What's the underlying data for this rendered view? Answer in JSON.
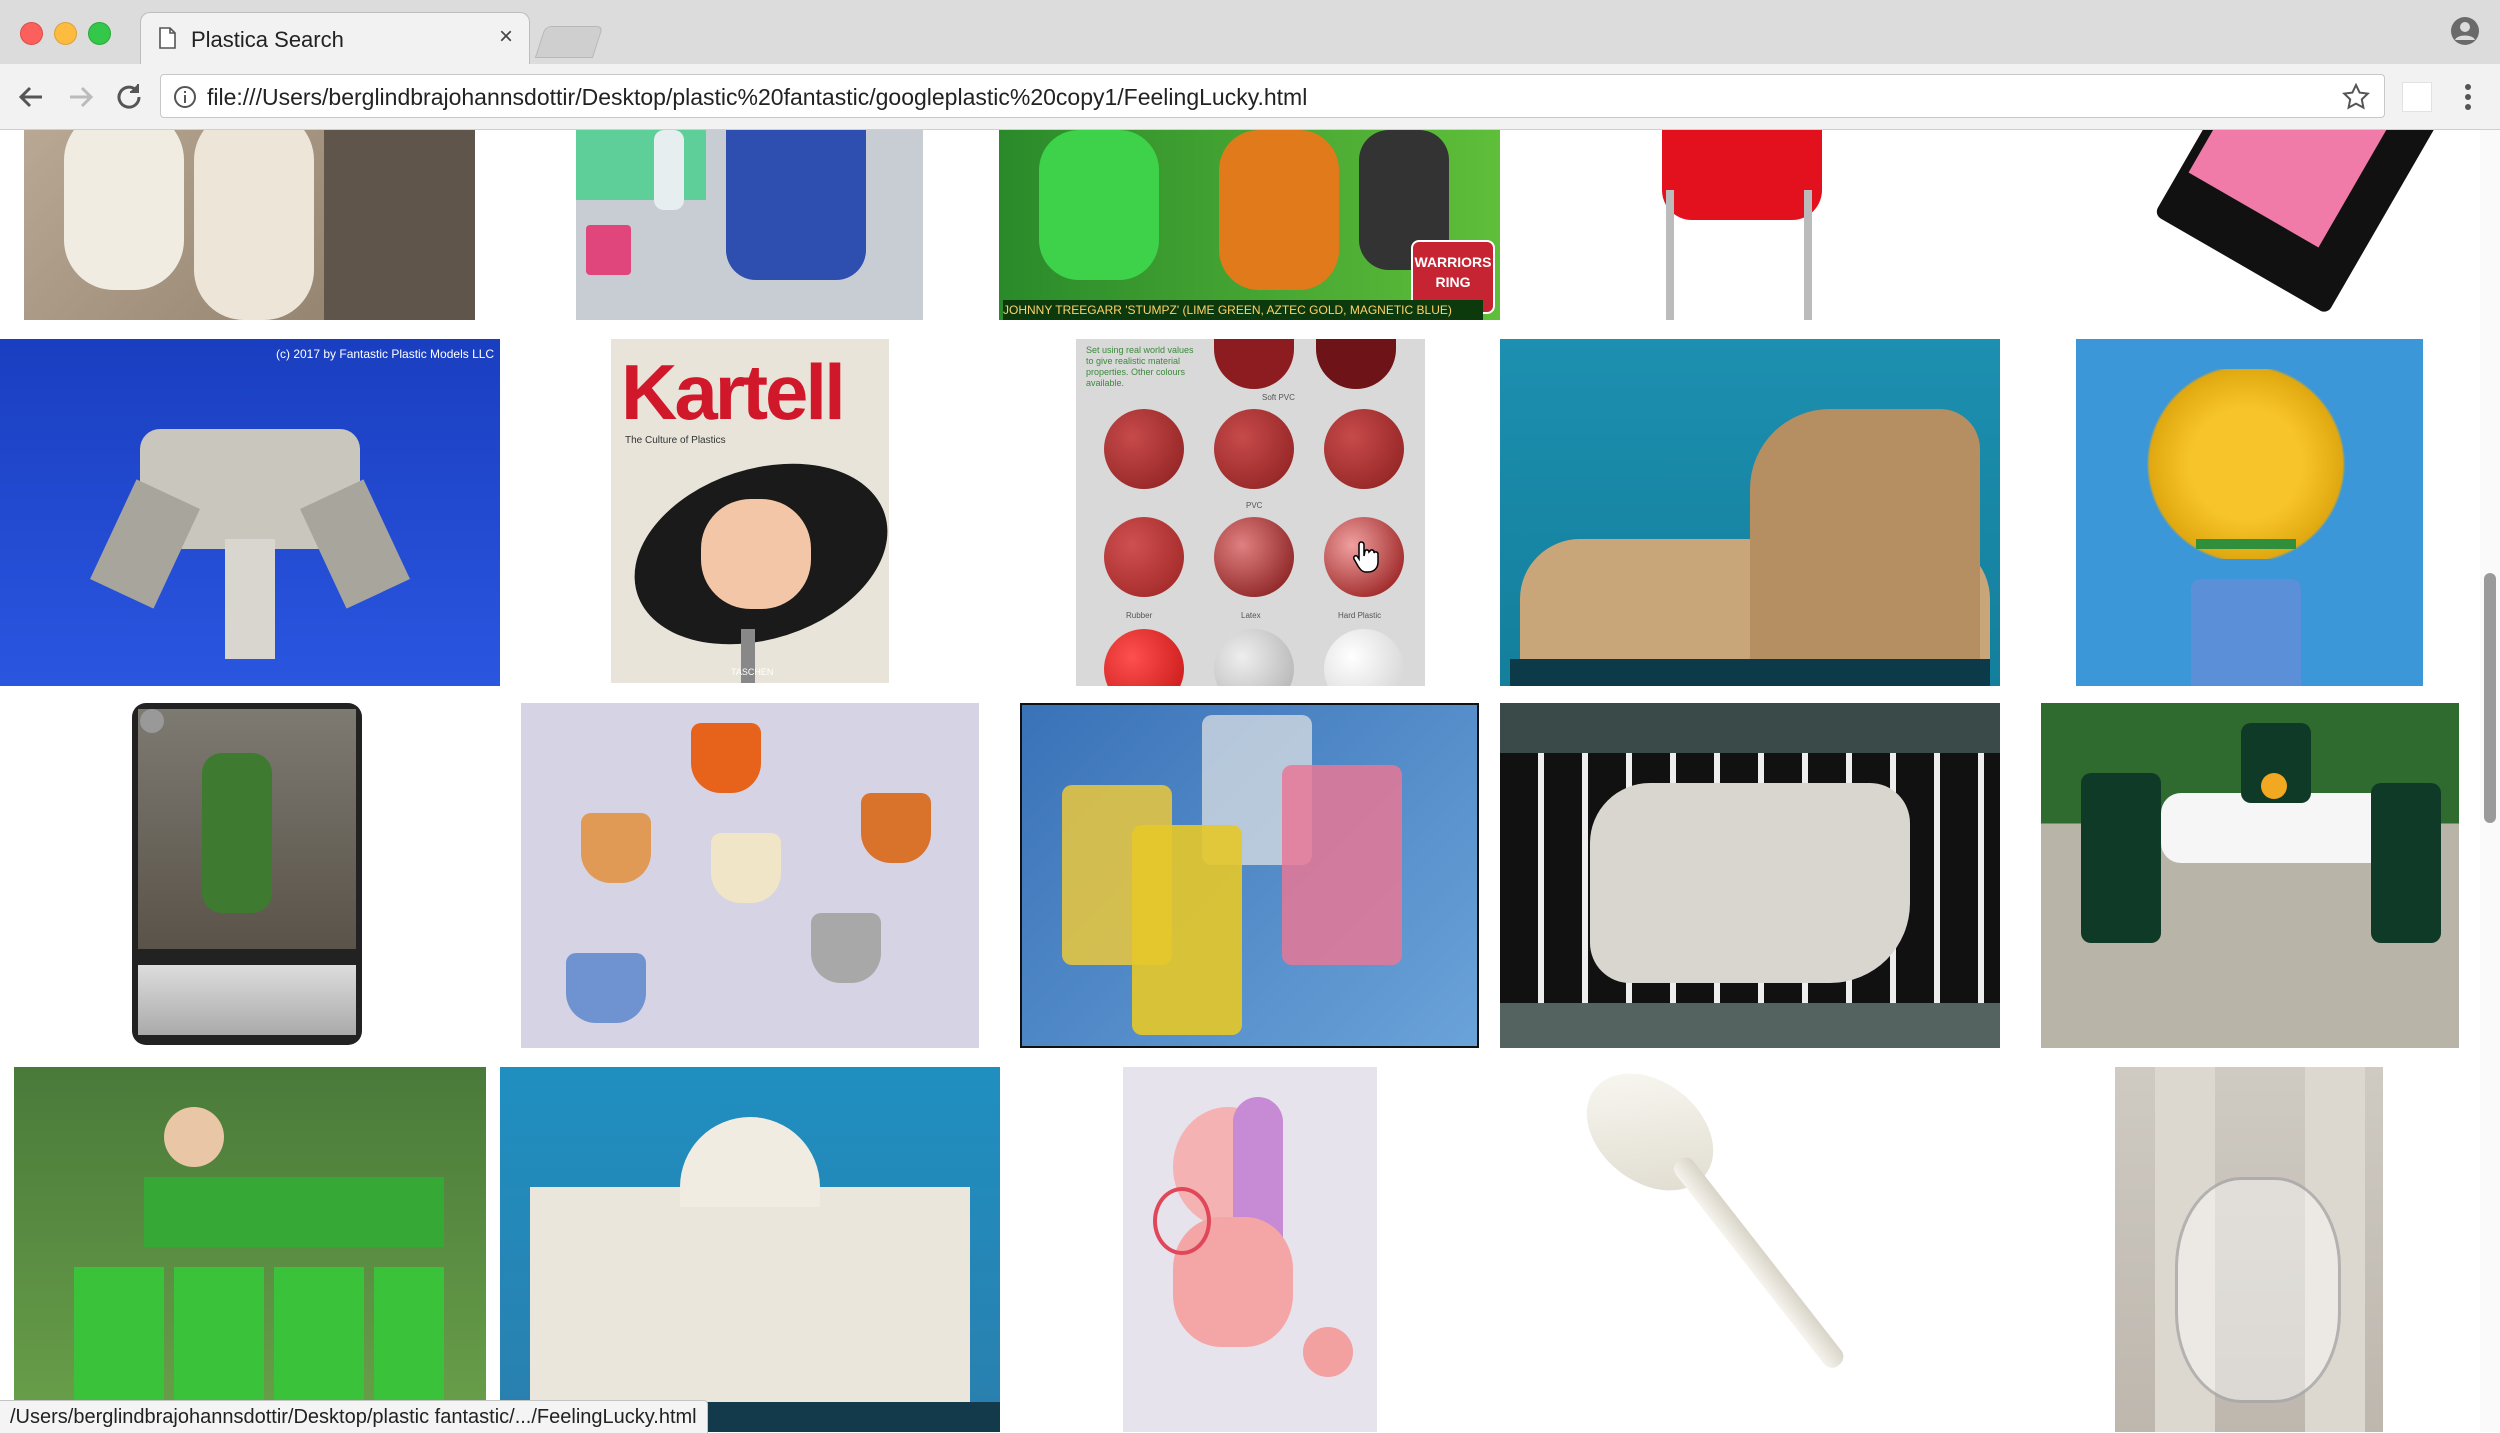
{
  "browser": {
    "tab_title": "Plastica Search",
    "tab_close": "×",
    "url": "file:///Users/berglindbrajohannsdottir/Desktop/plastic%20fantastic/googleplastic%20copy1/FeelingLucky.html",
    "status_url": "/Users/berglindbrajohannsdottir/Desktop/plastic fantastic/.../FeelingLucky.html"
  },
  "image_text": {
    "warriors_caption": "JOHNNY TREEGARR 'STUMPZ' (LIME GREEN, AZTEC GOLD, MAGNETIC BLUE)",
    "warriors_logo": "WARRIORS",
    "warriors_ring": "RING",
    "spaceship_copyright": "(c) 2017 by Fantastic Plastic Models LLC",
    "kartell_title": "Kartell",
    "kartell_subtitle": "The Culture of Plastics",
    "kartell_publisher": "TASCHEN",
    "color_chart_note": "Set using real world values to give realistic material properties. Other colours available.",
    "chart_soft_pvc": "Soft PVC",
    "chart_pvc": "PVC",
    "chart_rubber": "Rubber",
    "chart_latex": "Latex",
    "chart_hard_plastic": "Hard Plastic"
  },
  "images": [
    {
      "id": "white-plastic-cylinders",
      "desc": "white plastic cylinders in hand"
    },
    {
      "id": "blue-bucket",
      "desc": "blue plastic bucket"
    },
    {
      "id": "warriors-figures",
      "desc": "green orange figurines"
    },
    {
      "id": "red-chair",
      "desc": "red plastic chair"
    },
    {
      "id": "pink-compact",
      "desc": "pink blush compact"
    },
    {
      "id": "spaceship-model",
      "desc": "spaceship model on blue"
    },
    {
      "id": "kartell-book",
      "desc": "Kartell book cover"
    },
    {
      "id": "material-color-chart",
      "desc": "red material spheres chart"
    },
    {
      "id": "colosseum-model",
      "desc": "colosseum model"
    },
    {
      "id": "yellow-flowers-vase",
      "desc": "yellow flowers in blue jug"
    },
    {
      "id": "green-army-man",
      "desc": "green toy soldier card"
    },
    {
      "id": "plastic-thimbles",
      "desc": "plastic thimbles"
    },
    {
      "id": "pellet-vials",
      "desc": "vials with pellets"
    },
    {
      "id": "plastic-figure-floor",
      "desc": "figure on checkered floor"
    },
    {
      "id": "garden-furniture",
      "desc": "patio table and chairs"
    },
    {
      "id": "people-with-bins",
      "desc": "people with green bins"
    },
    {
      "id": "building-model",
      "desc": "white building model"
    },
    {
      "id": "pony-toy",
      "desc": "pink pony toy"
    },
    {
      "id": "plastic-spoon",
      "desc": "white plastic spoon"
    },
    {
      "id": "clear-plastic-bag",
      "desc": "clear plastic handbag"
    }
  ],
  "colors": {
    "chrome_bg": "#dcdcdc",
    "toolbar_bg": "#f2f2f2",
    "accent_red": "#c62433"
  }
}
